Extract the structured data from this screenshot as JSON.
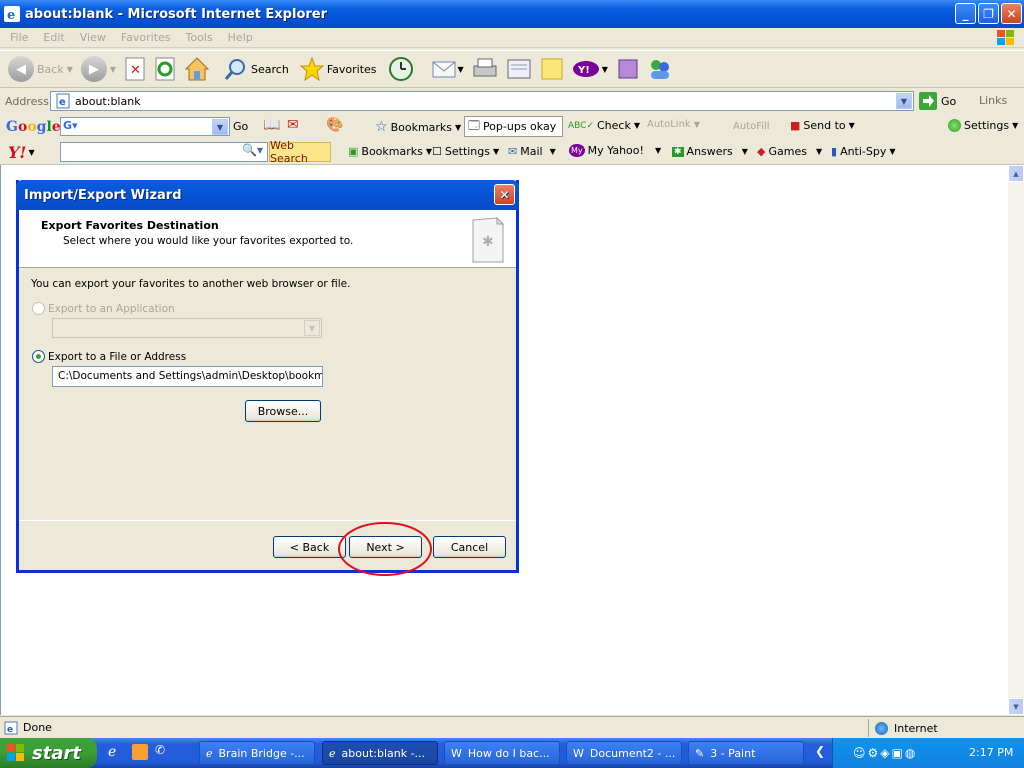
{
  "window": {
    "title": "about:blank - Microsoft Internet Explorer"
  },
  "menu": [
    "File",
    "Edit",
    "View",
    "Favorites",
    "Tools",
    "Help"
  ],
  "toolbar": {
    "back": "Back",
    "search": "Search",
    "favorites": "Favorites"
  },
  "address": {
    "label": "Address",
    "value": "about:blank",
    "go": "Go",
    "links": "Links"
  },
  "google_bar": {
    "go": "Go",
    "bookmarks": "Bookmarks",
    "popups": "Pop-ups okay",
    "check": "Check",
    "autolink": "AutoLink",
    "autofill": "AutoFill",
    "sendto": "Send to",
    "settings": "Settings"
  },
  "yahoo_bar": {
    "web_search": "Web Search",
    "bookmarks": "Bookmarks",
    "settings": "Settings",
    "mail": "Mail",
    "my_yahoo": "My Yahoo!",
    "answers": "Answers",
    "games": "Games",
    "antispy": "Anti-Spy"
  },
  "dialog": {
    "title": "Import/Export Wizard",
    "heading": "Export Favorites Destination",
    "subheading": "Select where you would like your favorites exported to.",
    "intro": "You can export your favorites to another web browser or file.",
    "option_app": "Export to an Application",
    "option_file": "Export to a File or Address",
    "file_path": "C:\\Documents and Settings\\admin\\Desktop\\bookmark.",
    "browse": "Browse...",
    "back": "< Back",
    "next": "Next >",
    "cancel": "Cancel"
  },
  "status": {
    "text": "Done",
    "zone": "Internet"
  },
  "taskbar": {
    "start": "start",
    "tasks": [
      "Brain Bridge -...",
      "about:blank -...",
      "How do I bac...",
      "Document2 - ...",
      "3 - Paint"
    ],
    "clock": "2:17 PM"
  },
  "colors": {
    "xp_blue": "#0a5fde",
    "start_green": "#3c9e37",
    "highlight_red": "#e0101a"
  }
}
